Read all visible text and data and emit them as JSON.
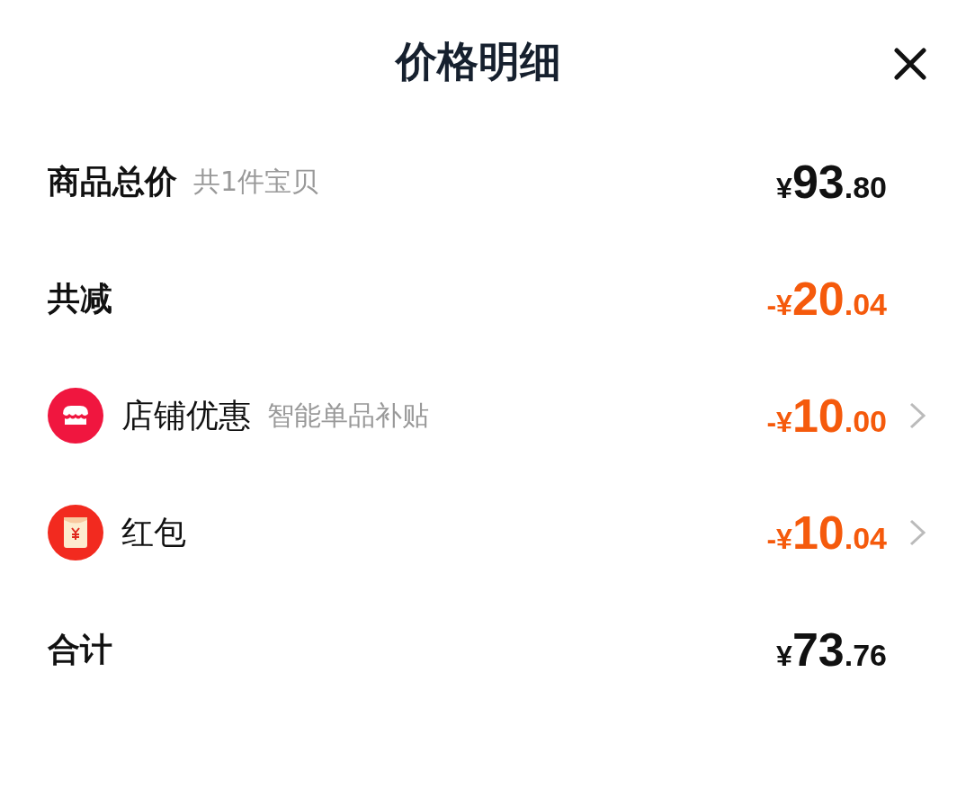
{
  "title": "价格明细",
  "rows": [
    {
      "kind": "heading",
      "label": "商品总价",
      "note": "共1件宝贝",
      "amount": {
        "kind": "plain",
        "prefix": "¥",
        "integer": "93",
        "decimal": ".80"
      }
    },
    {
      "kind": "heading",
      "label": "共减",
      "amount": {
        "kind": "deduction",
        "prefix": "-¥",
        "integer": "20",
        "decimal": ".04"
      }
    },
    {
      "kind": "store",
      "label": "店铺优惠",
      "note": "智能单品补贴",
      "amount": {
        "kind": "deduction",
        "prefix": "-¥",
        "integer": "10",
        "decimal": ".00"
      }
    },
    {
      "kind": "envelope",
      "label": "红包",
      "amount": {
        "kind": "deduction",
        "prefix": "-¥",
        "integer": "10",
        "decimal": ".04"
      }
    },
    {
      "kind": "heading",
      "label": "合计",
      "amount": {
        "kind": "plain",
        "prefix": "¥",
        "integer": "73",
        "decimal": ".76"
      }
    }
  ]
}
